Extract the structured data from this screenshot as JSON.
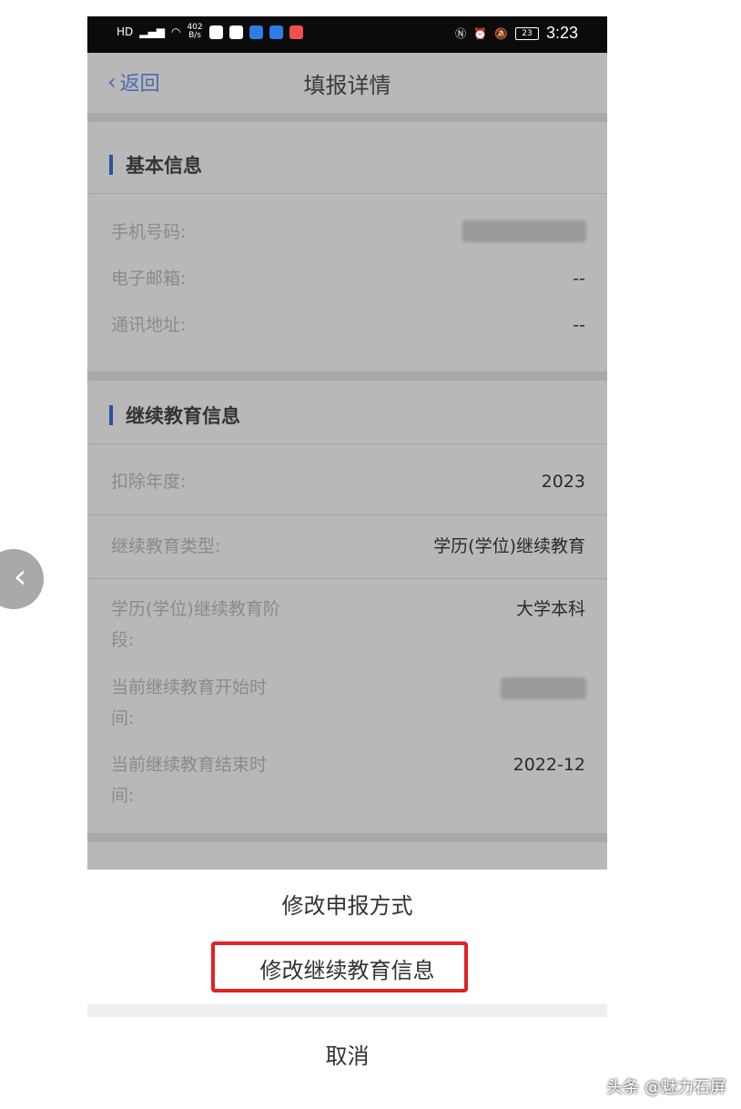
{
  "status_bar": {
    "left_label": "HD",
    "speed_top": "402",
    "speed_bottom": "B/s",
    "battery": "23",
    "time": "3:23"
  },
  "nav": {
    "back_label": "返回",
    "title": "填报详情"
  },
  "basic_info": {
    "title": "基本信息",
    "rows": [
      {
        "label": "手机号码:",
        "value": ""
      },
      {
        "label": "电子邮箱:",
        "value": "--"
      },
      {
        "label": "通讯地址:",
        "value": "--"
      }
    ]
  },
  "edu_info": {
    "title": "继续教育信息",
    "rows": [
      {
        "label": "扣除年度:",
        "value": "2023"
      },
      {
        "label": "继续教育类型:",
        "value": "学历(学位)继续教育"
      },
      {
        "label": "学历(学位)继续教育阶段:",
        "label_line1": "学历(学位)继续教育阶",
        "label_line2": "段:",
        "value": "大学本科"
      },
      {
        "label": "当前继续教育开始时间:",
        "label_line1": "当前继续教育开始时",
        "label_line2": "间:",
        "value": ""
      },
      {
        "label": "当前继续教育结束时间:",
        "label_line1": "当前继续教育结束时",
        "label_line2": "间:",
        "value": "2022-12"
      }
    ]
  },
  "action_sheet": {
    "items": [
      "修改申报方式",
      "修改继续教育信息"
    ],
    "cancel": "取消"
  },
  "watermark": "头条 @魅力石屏",
  "colors": {
    "accent": "#4b6cae",
    "highlight": "#e02222",
    "overlay": "#b8b8b8"
  }
}
